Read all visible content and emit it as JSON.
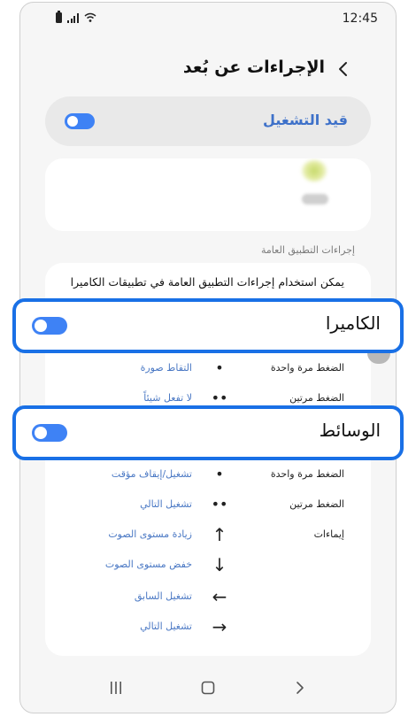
{
  "status_bar": {
    "time": "12:45",
    "icons": [
      "battery-icon",
      "signal-icon",
      "wifi-icon"
    ]
  },
  "header": {
    "title": "الإجراءات عن بُعد",
    "back_icon": "chevron-left-icon"
  },
  "main_toggle": {
    "label": "قيد التشغيل",
    "state": "on"
  },
  "section_label": "إجراءات التطبيق العامة",
  "description": "يمكن استخدام إجراءات التطبيق العامة في تطبيقات الكاميرا",
  "camera": {
    "label": "الكاميرا",
    "toggle_state": "on",
    "rows": [
      {
        "label": "الضغط مرة واحدة",
        "symbol": "•",
        "action": "التقاط صورة"
      },
      {
        "label": "الضغط مرتين",
        "symbol": "••",
        "action": "لا تفعل شيئاً"
      }
    ]
  },
  "media": {
    "label": "الوسائط",
    "toggle_state": "on",
    "rows": [
      {
        "label": "الضغط مرة واحدة",
        "symbol": "•",
        "action": "تشغيل/إيقاف مؤقت"
      },
      {
        "label": "الضغط مرتين",
        "symbol": "••",
        "action": "تشغيل التالي"
      },
      {
        "label": "إيماءات",
        "symbol": "↑",
        "action": "زيادة مستوى الصوت"
      },
      {
        "label": "",
        "symbol": "↓",
        "action": "خفض مستوى الصوت"
      },
      {
        "label": "",
        "symbol": "←",
        "action": "تشغيل السابق"
      },
      {
        "label": "",
        "symbol": "→",
        "action": "تشغيل التالي"
      }
    ]
  },
  "colors": {
    "accent": "#3e82f5",
    "highlight_border": "#1970e6",
    "link": "#4a78c4",
    "background": "#f6f6f6"
  },
  "nav_bar": {
    "icons": [
      "recents-icon",
      "home-icon",
      "back-icon"
    ]
  }
}
